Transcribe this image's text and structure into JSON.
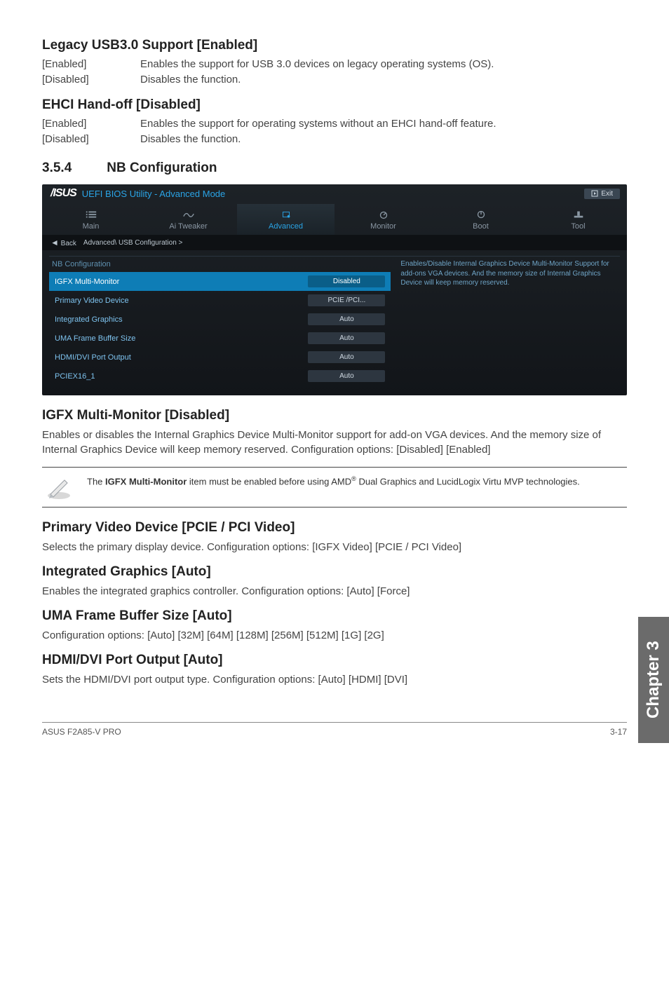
{
  "s1": {
    "title": "Legacy USB3.0 Support [Enabled]",
    "r1k": "[Enabled]",
    "r1v": "Enables the support for USB 3.0 devices on legacy operating systems (OS).",
    "r2k": "[Disabled]",
    "r2v": "Disables the function."
  },
  "s2": {
    "title": "EHCI Hand-off [Disabled]",
    "r1k": "[Enabled]",
    "r1v": "Enables the support for operating systems without an EHCI hand-off feature.",
    "r2k": "[Disabled]",
    "r2v": "Disables the function."
  },
  "num": {
    "n": "3.5.4",
    "t": "NB Configuration"
  },
  "bios": {
    "title": "UEFI BIOS Utility - Advanced Mode",
    "exit": "Exit",
    "tabs": {
      "main": "Main",
      "tweaker": "Ai Tweaker",
      "advanced": "Advanced",
      "monitor": "Monitor",
      "boot": "Boot",
      "tool": "Tool"
    },
    "back": "Back",
    "breadcrumb": "Advanced\\ USB Configuration  >",
    "header_row": "NB Configuration",
    "rows": {
      "r1l": "IGFX Multi-Monitor",
      "r1v": "Disabled",
      "r2l": "Primary Video Device",
      "r2v": "PCIE /PCI...",
      "r3l": "Integrated Graphics",
      "r3v": "Auto",
      "r4l": "UMA Frame Buffer Size",
      "r4v": "Auto",
      "r5l": "HDMI/DVI Port Output",
      "r5v": "Auto",
      "r6l": "PCIEX16_1",
      "r6v": "Auto"
    },
    "help": "Enables/Disable Internal Graphics Device Multi-Monitor Support for add-ons VGA devices. And the memory size of Internal Graphics Device will keep memory reserved."
  },
  "s3": {
    "title": "IGFX Multi-Monitor [Disabled]",
    "p1": "Enables or disables the Internal Graphics Device Multi-Monitor support for add-on VGA devices. And the memory size of Internal Graphics Device will keep memory reserved. Configuration options: [Disabled] [Enabled]"
  },
  "note": {
    "pre": "The ",
    "bold": "IGFX Multi-Monitor",
    "mid": " item must be enabled before using AMD",
    "sup": "®",
    "post": " Dual Graphics and LucidLogix Virtu MVP technologies."
  },
  "s4": {
    "title": "Primary Video Device [PCIE / PCI Video]",
    "p": "Selects the primary display device. Configuration options: [IGFX Video] [PCIE / PCI Video]"
  },
  "s5": {
    "title": "Integrated Graphics [Auto]",
    "p": "Enables the integrated graphics controller. Configuration options: [Auto] [Force]"
  },
  "s6": {
    "title": "UMA Frame Buffer Size [Auto]",
    "p": "Configuration options: [Auto] [32M] [64M] [128M] [256M] [512M] [1G] [2G]"
  },
  "s7": {
    "title": "HDMI/DVI Port Output [Auto]",
    "p": "Sets the HDMI/DVI port output type. Configuration options: [Auto] [HDMI] [DVI]"
  },
  "sidetab": "Chapter 3",
  "footer": {
    "left": "ASUS F2A85-V PRO",
    "right": "3-17"
  }
}
